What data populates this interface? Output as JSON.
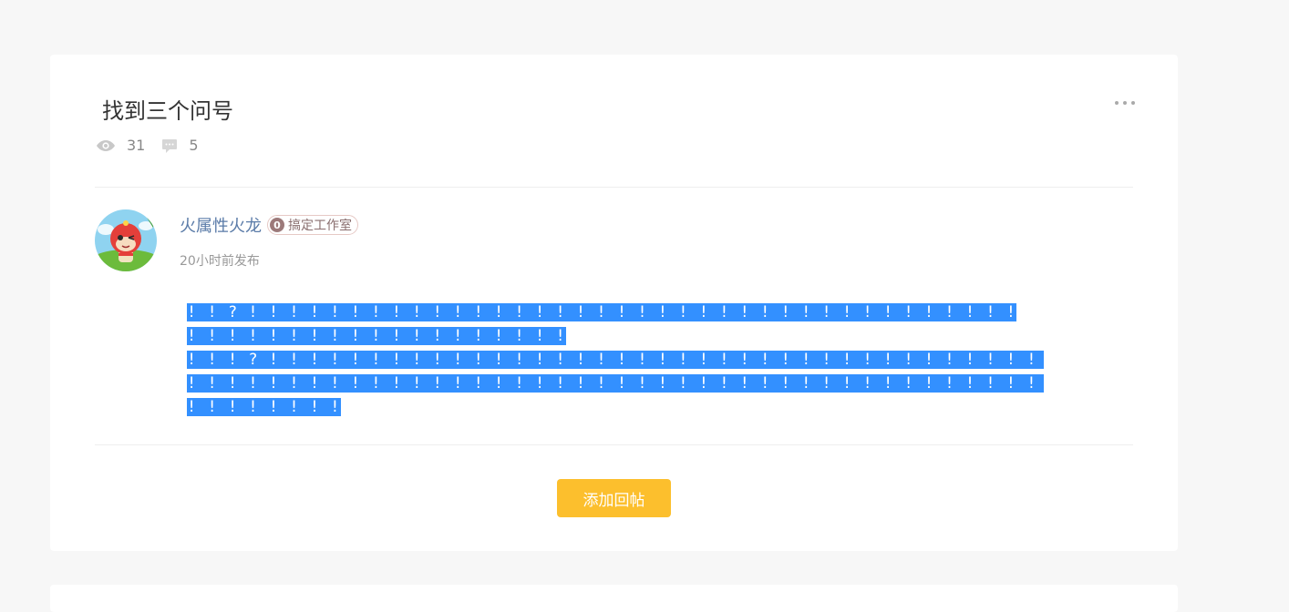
{
  "post": {
    "title": "找到三个问号",
    "views": "31",
    "comments": "5",
    "author": {
      "name": "火属性火龙",
      "badge_icon_text": "0",
      "badge_label": "搞定工作室",
      "posted_time": "20小时前发布"
    },
    "content_lines": [
      "! ! ? ! ! ! ! ! ! ! ! ! ! ! ! ! ! ! ! ! ! ! ! ! ! ! ! ! ! ! ! ! ! ! ! ! ! ! ! ! !",
      "! ! ! ! ! ! ! ! ! ! ! ! ! ! ! ! ! ! !",
      "! ! ! ? ! ! ! ! ! ! ! ! ! ! ! ! ! ! ! ! ! ! ! ! ! ! ! ! ! ! ! ! ! ! ! ! ! ! ! ! ! ! !",
      "! ! ! ! ! ! ! ! ! ! ! ! ! ! ! ! ! ! ! ! ! ! ! ! ! ! ! ! ! ! ! ! ! ! ! ! ! ! ! ! ! ! ! ? ! ! ! ! ! ! ! ! !",
      "! ! ! ! ! ! ! !"
    ]
  },
  "actions": {
    "reply_label": "添加回帖"
  },
  "colors": {
    "selection": "#3390ff",
    "button": "#fcbf2d",
    "author_link": "#5a7ba8"
  }
}
